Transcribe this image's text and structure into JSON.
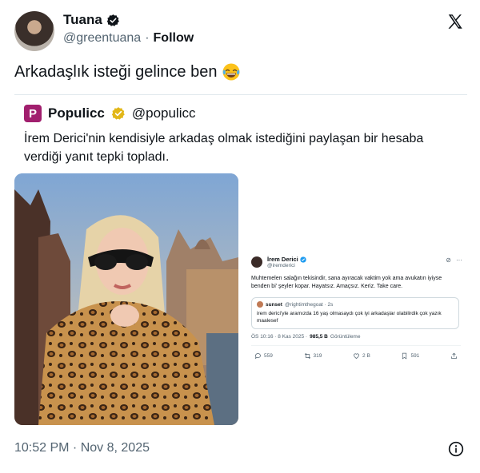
{
  "author": {
    "display_name": "Tuana",
    "handle": "@greentuana",
    "separator": "·",
    "follow_label": "Follow"
  },
  "tweet": {
    "text": "Arkadaşlık isteği gelince ben",
    "emoji": "face-with-tears-of-joy"
  },
  "quote": {
    "avatar_letter": "P",
    "name": "Populicc",
    "handle": "@populicc",
    "text": "İrem Derici'nin kendisiyle arkadaş olmak istediğini paylaşan bir hesaba verdiği yanıt tepki topladı."
  },
  "embedded": {
    "name": "İrem Derici",
    "handle": "@iremderici",
    "body": "Muhtemelen salağın tekisindir, sana ayıracak vaktim yok ama avukatın iyiyse benden bi' şeyler kopar. Hayatsız. Amaçsız. Keriz. Take care.",
    "quoted": {
      "name": "sunset",
      "handle": "@rightimthegoat · 2s",
      "text": "irem derici'yle aramızda 16 yaş olmasaydı çok iyi arkadaşlar olabilirdik çok yazık maalesef"
    },
    "meta_time": "ÖS 10:16 · 8 Kas 2025 ·",
    "meta_views": "985,5 B",
    "meta_views_label": "Görüntüleme",
    "stats": {
      "replies": "559",
      "reposts": "319",
      "likes": "2 B",
      "bookmarks": "591"
    }
  },
  "footer": {
    "timestamp": "10:52 PM · Nov 8, 2025"
  },
  "colors": {
    "verified_gold": "#e2b719",
    "verified_blue": "#1d9bf0",
    "secondary_text": "#536471",
    "quote_avatar_bg": "#a11f6e"
  }
}
